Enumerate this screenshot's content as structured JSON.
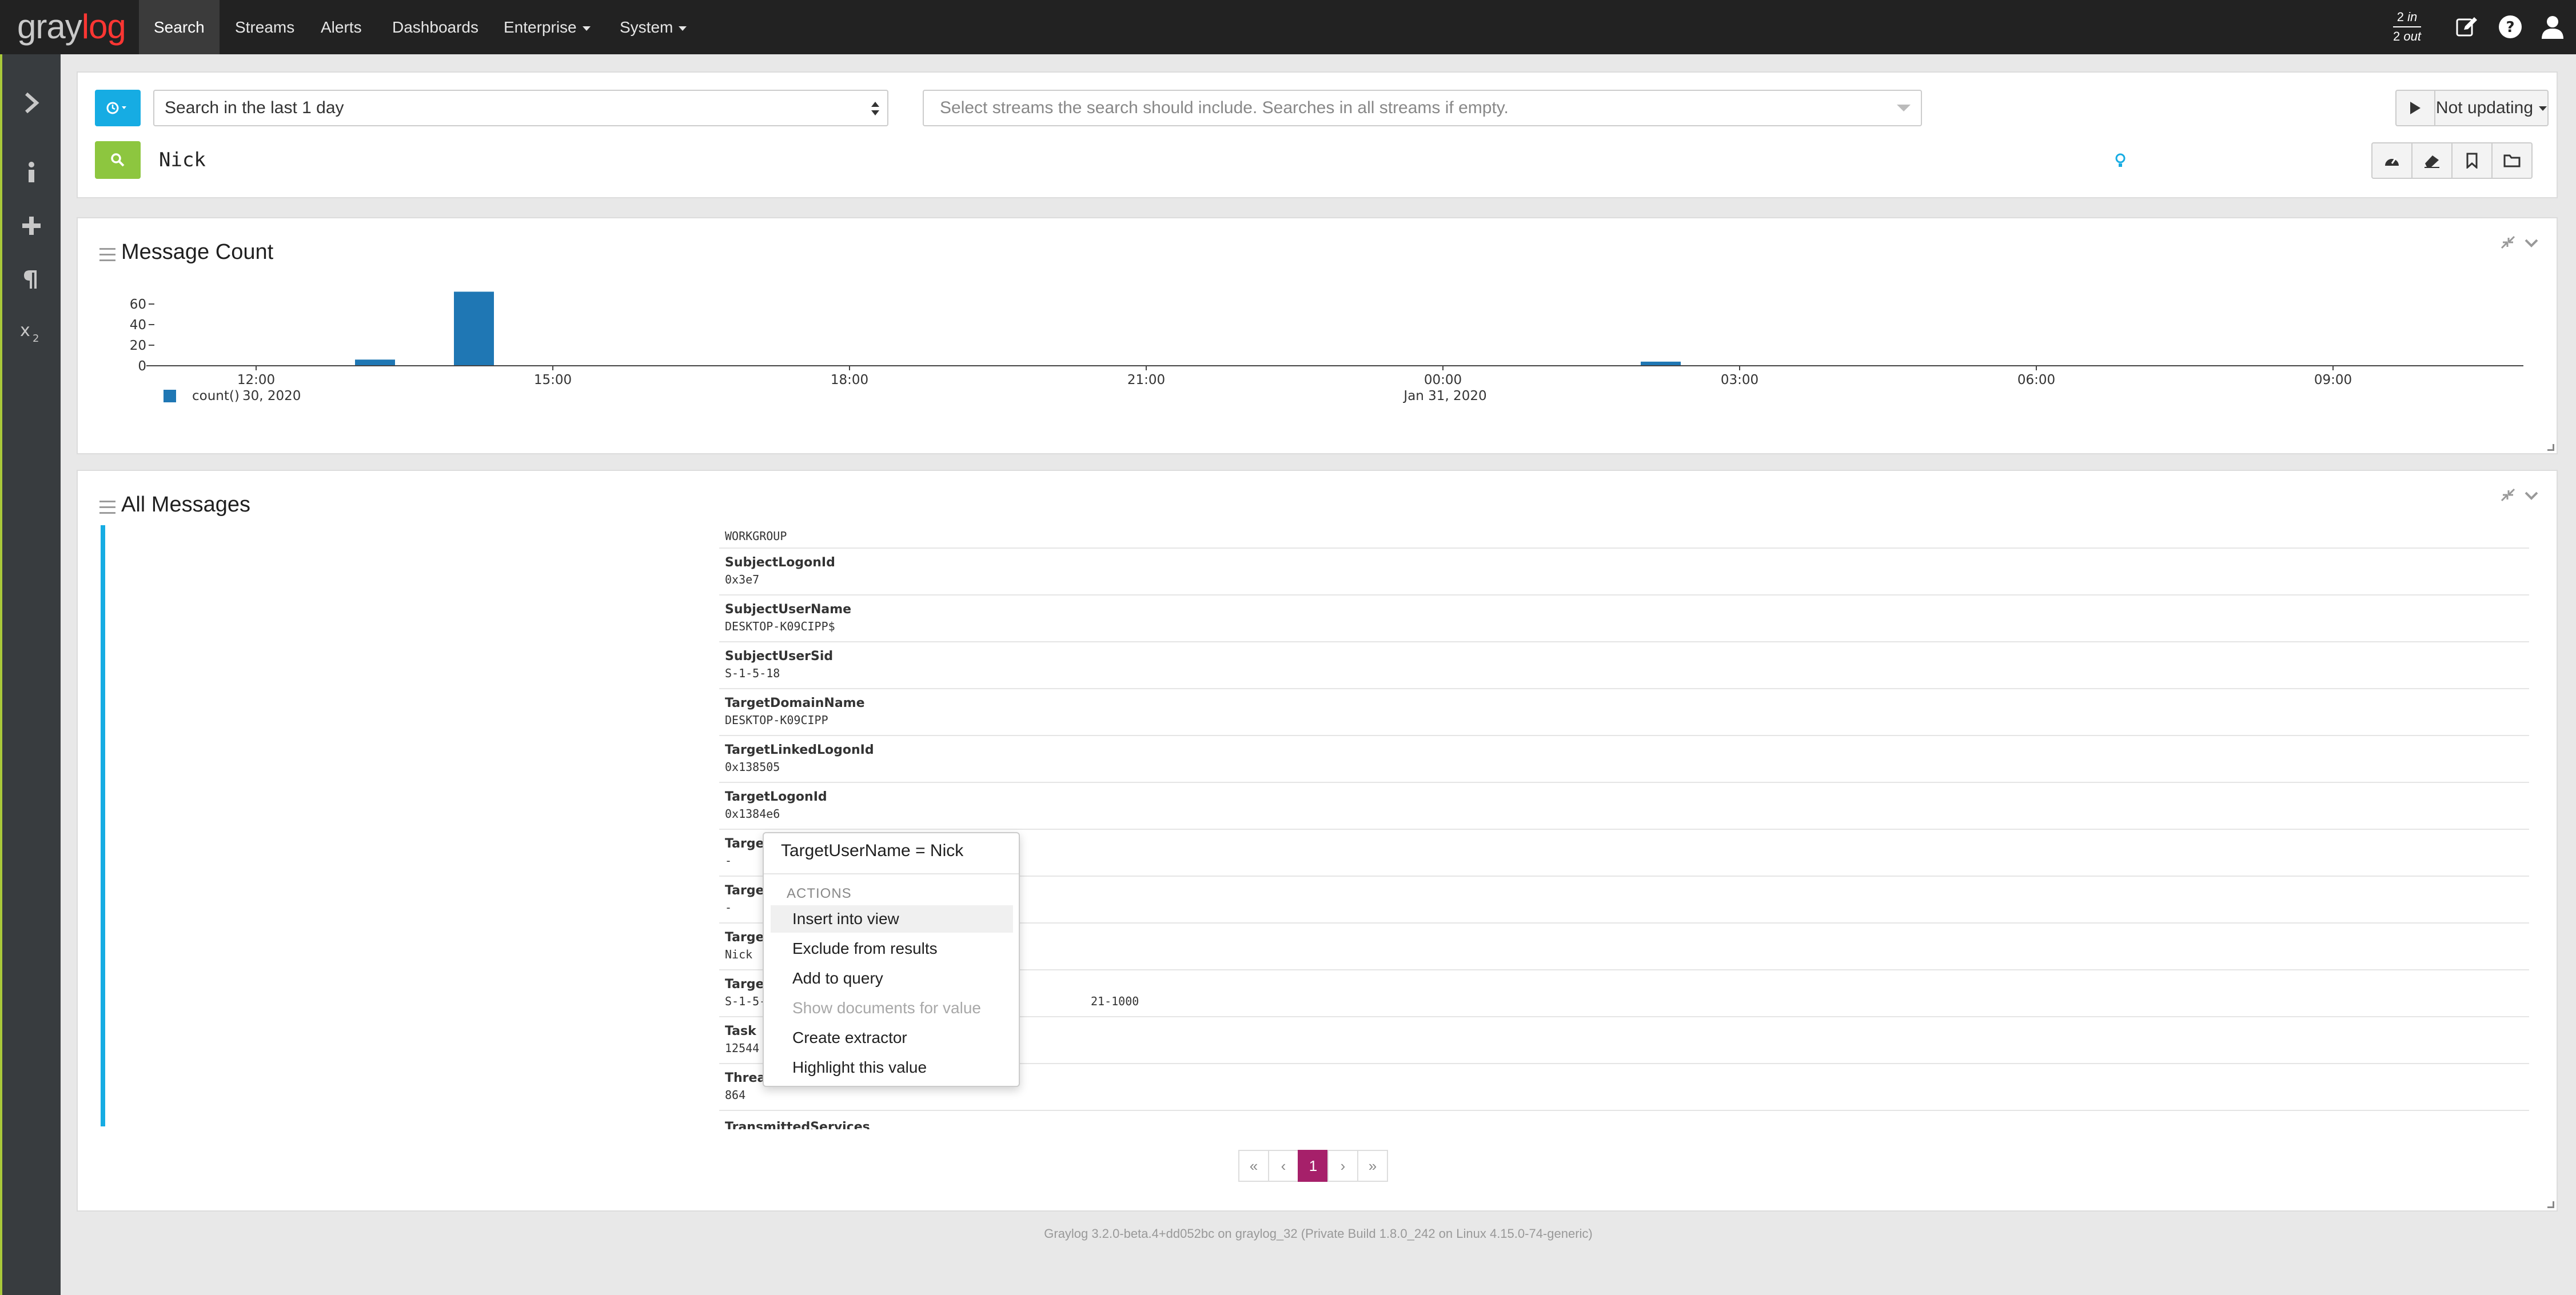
{
  "nav": {
    "logo_gray": "gray",
    "logo_red": "log",
    "items": [
      {
        "label": "Search",
        "active": true
      },
      {
        "label": "Streams"
      },
      {
        "label": "Alerts"
      },
      {
        "label": "Dashboards"
      },
      {
        "label": "Enterprise"
      },
      {
        "label": "System"
      }
    ],
    "throughput_in": "2",
    "throughput_in_label": "in",
    "throughput_out": "2",
    "throughput_out_label": "out"
  },
  "search": {
    "time_range": "Search in the last 1 day",
    "streams_placeholder": "Select streams the search should include. Searches in all streams if empty.",
    "refresh_label": "Not updating",
    "query": "Nick"
  },
  "message_count": {
    "title": "Message Count",
    "legend": "count()",
    "date_label_1": "30, 2020",
    "date_label_2": "Jan 31, 2020"
  },
  "chart_data": {
    "type": "bar",
    "x": [
      "13:00",
      "14:00",
      "02:00"
    ],
    "values": [
      6,
      72,
      4
    ],
    "x_tick_labels": [
      "12:00",
      "15:00",
      "18:00",
      "21:00",
      "00:00",
      "03:00",
      "06:00",
      "09:00"
    ],
    "y_tick_labels": [
      "60",
      "40",
      "20",
      "0"
    ],
    "ylim": [
      0,
      75
    ],
    "series": [
      {
        "name": "count()",
        "color": "#1f77b4"
      }
    ],
    "legend_position": "bottom-left",
    "grid": false
  },
  "all_messages": {
    "title": "All Messages",
    "partial_top_value": "WORKGROUP",
    "fields": [
      {
        "name": "SubjectLogonId",
        "value": "0x3e7"
      },
      {
        "name": "SubjectUserName",
        "value": "DESKTOP-K09CIPP$"
      },
      {
        "name": "SubjectUserSid",
        "value": "S-1-5-18"
      },
      {
        "name": "TargetDomainName",
        "value": "DESKTOP-K09CIPP"
      },
      {
        "name": "TargetLinkedLogonId",
        "value": "0x138505"
      },
      {
        "name": "TargetLogonId",
        "value": "0x1384e6"
      },
      {
        "name": "Target",
        "value": "-"
      },
      {
        "name": "Target",
        "value": "-"
      },
      {
        "name": "Target",
        "value": "Nick"
      },
      {
        "name": "Target",
        "value": "S-1-5-",
        "value_tail": "21-1000"
      },
      {
        "name": "Task",
        "value": "12544"
      },
      {
        "name": "Thread",
        "value": "864"
      },
      {
        "name": "TransmittedServices",
        "value": ""
      }
    ],
    "pagination": [
      "«",
      "‹",
      "1",
      "›",
      "»"
    ]
  },
  "context_menu": {
    "title": "TargetUserName = Nick",
    "header": "ACTIONS",
    "items": [
      {
        "label": "Insert into view"
      },
      {
        "label": "Exclude from results"
      },
      {
        "label": "Add to query"
      },
      {
        "label": "Show documents for value",
        "disabled": true
      },
      {
        "label": "Create extractor"
      },
      {
        "label": "Highlight this value"
      }
    ]
  },
  "footer": "Graylog 3.2.0-beta.4+dd052bc on graylog_32 (Private Build 1.8.0_242 on Linux 4.15.0-74-generic)",
  "colors": {
    "navbar": "#222222",
    "accent_blue": "#16ace3",
    "search_green": "#8dc63f",
    "page_active": "#a6206a",
    "bar": "#1f77b4"
  }
}
